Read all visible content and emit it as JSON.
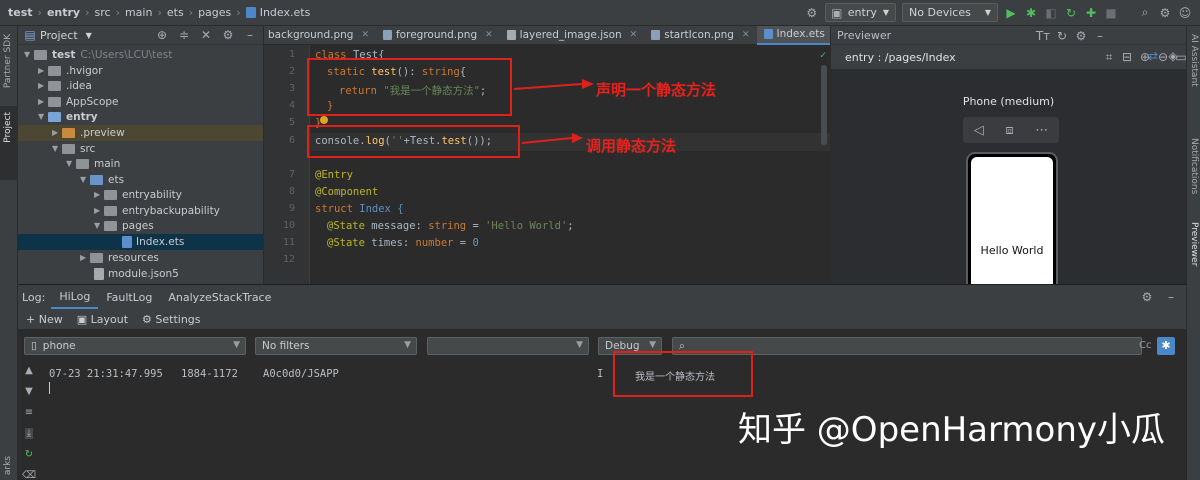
{
  "navbar": {
    "breadcrumb": [
      "test",
      "entry",
      "src",
      "main",
      "ets",
      "pages",
      "Index.ets"
    ],
    "run_config": "entry",
    "device": "No Devices"
  },
  "left_strip": {
    "top_label": "Partner SDK",
    "project_label": "Project",
    "bottom_label": "arks"
  },
  "project_panel": {
    "title": "Project",
    "root_name": "test",
    "root_path": "C:\\Users\\LCU\\test",
    "items": [
      {
        "label": ".hvigor"
      },
      {
        "label": ".idea"
      },
      {
        "label": "AppScope"
      },
      {
        "label": "entry"
      },
      {
        "label": ".preview"
      },
      {
        "label": "src"
      },
      {
        "label": "main"
      },
      {
        "label": "ets"
      },
      {
        "label": "entryability"
      },
      {
        "label": "entrybackupability"
      },
      {
        "label": "pages"
      },
      {
        "label": "Index.ets"
      },
      {
        "label": "resources"
      },
      {
        "label": "module.json5"
      }
    ]
  },
  "editor": {
    "tabs": [
      {
        "label": "background.png"
      },
      {
        "label": "foreground.png"
      },
      {
        "label": "layered_image.json"
      },
      {
        "label": "startIcon.png"
      },
      {
        "label": "Index.ets"
      }
    ],
    "line_numbers": [
      "1",
      "2",
      "3",
      "4",
      "5",
      "6",
      "7",
      "8",
      "9",
      "10",
      "11",
      "12"
    ],
    "code": {
      "l1_kw": "class",
      "l1_name": "Test{",
      "l2_kw": "static",
      "l2_fn": "test",
      "l2_rest": "(): ",
      "l2_ty": "string",
      "l2_brace": "{",
      "l3_kw": "return",
      "l3_str": "\"我是一个静态方法\"",
      "l3_end": ";",
      "l4": "}",
      "l5": "}",
      "l6_a": "console.",
      "l6_fn": "log",
      "l6_b": "(",
      "l6_str": "''",
      "l6_c": "+Test.",
      "l6_fn2": "test",
      "l6_d": "());",
      "l8": "@Entry",
      "l9": "@Component",
      "l10_kw": "struct",
      "l10_name": "Index {",
      "l11_dec": "@State",
      "l11_prop": "message",
      "l11_c": ": ",
      "l11_ty": "string",
      "l11_eq": " = ",
      "l11_str": "'Hello World'",
      "l11_end": ";",
      "l12_dec": "@State",
      "l12_prop": "times",
      "l12_c": ": ",
      "l12_ty": "number",
      "l12_eq": " = ",
      "l12_num": "0"
    },
    "annotation_1": "声明一个静态方法",
    "annotation_2": "调用静态方法"
  },
  "previewer": {
    "title": "Previewer",
    "path": "entry : /pages/Index",
    "device_name": "Phone (medium)",
    "screen_text": "Hello World"
  },
  "right_strip": {
    "label_1": "AI Assistant",
    "label_2": "Notifications",
    "label_3": "Previewer"
  },
  "log": {
    "label": "Log:",
    "tabs": [
      "HiLog",
      "FaultLog",
      "AnalyzeStackTrace"
    ],
    "toolbar": {
      "new": "New",
      "layout": "Layout",
      "settings": "Settings"
    },
    "device_filter": "phone",
    "process_filter": "No filters",
    "level_filter": "Debug",
    "regex_label": "Cc",
    "entry": {
      "time": "07-23 21:31:47.995",
      "pid": "1884-1172",
      "tag": "A0c0d0/JSAPP",
      "level": "I",
      "message": "我是一个静态方法"
    }
  },
  "watermark": "知乎 @OpenHarmony小瓜",
  "colors": {
    "annotation_red": "#e0201b",
    "accent_blue": "#4a88c7",
    "run_green": "#4fbf5d"
  }
}
